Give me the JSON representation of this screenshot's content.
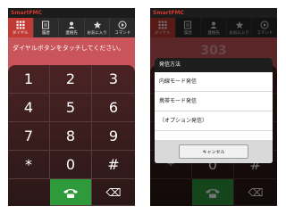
{
  "app": {
    "title": "SmartFMC"
  },
  "tabs": [
    {
      "label": "ダイヤル",
      "icon": "keypad-icon"
    },
    {
      "label": "履歴",
      "icon": "history-icon"
    },
    {
      "label": "連絡先",
      "icon": "contacts-icon"
    },
    {
      "label": "お気に入り",
      "icon": "star-icon"
    },
    {
      "label": "コマンド",
      "icon": "command-icon"
    }
  ],
  "dialer": {
    "prompt": "ダイヤルボタンをタッチしてください。",
    "keys": [
      "1",
      "2",
      "3",
      "4",
      "5",
      "6",
      "7",
      "8",
      "9",
      "*",
      "0",
      "#"
    ],
    "backspace_glyph": "⌫"
  },
  "right": {
    "number_display": "303",
    "dialog": {
      "title": "発信方法",
      "options": [
        "内線モード発信",
        "携帯モード発信",
        "（オプション発信）"
      ],
      "cancel_label": "キャンセル"
    }
  },
  "colors": {
    "active_tab": "#c23a34",
    "call": "#2f9a3b",
    "status_title": "#d63a2f"
  }
}
